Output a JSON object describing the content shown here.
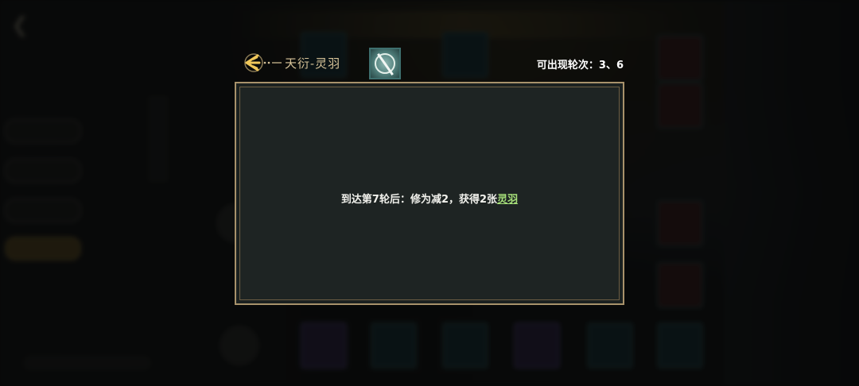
{
  "header": {
    "title": "天衍-灵羽",
    "map_icon": "compass-map-icon",
    "rounds_text": "可出现轮次：3、6"
  },
  "panel": {
    "effect_text": "到达第7轮后：修为减2，获得2张",
    "keyword": "灵羽"
  },
  "colors": {
    "panel_border": "#a8926b",
    "panel_bg": "#1e2423",
    "title_gold": "#d9c59a",
    "keyword_green": "#a7e07a"
  }
}
